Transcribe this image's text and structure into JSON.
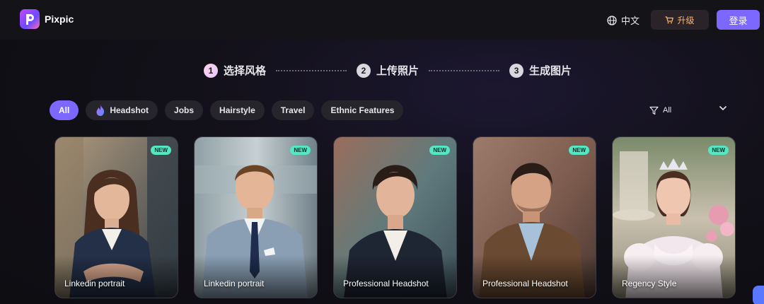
{
  "header": {
    "app_name": "Pixpic",
    "language_label": "中文",
    "upgrade_label": "升级",
    "login_label": "登录"
  },
  "steps": [
    {
      "num": "1",
      "label": "选择风格",
      "active": true
    },
    {
      "num": "2",
      "label": "上传照片",
      "active": false
    },
    {
      "num": "3",
      "label": "生成图片",
      "active": false
    }
  ],
  "filters": {
    "chips": [
      "All",
      "Headshot",
      "Jobs",
      "Hairstyle",
      "Travel",
      "Ethnic Features"
    ],
    "active": "All",
    "select_value": "All"
  },
  "cards": [
    {
      "label": "Linkedin portrait",
      "badge": "NEW"
    },
    {
      "label": "Linkedin portrait",
      "badge": "NEW"
    },
    {
      "label": "Professional Headshot",
      "badge": "NEW"
    },
    {
      "label": "Professional Headshot",
      "badge": "NEW"
    },
    {
      "label": "Regency Style",
      "badge": "NEW"
    }
  ],
  "colors": {
    "accent": "#7c68ff",
    "badge": "#52e8c4",
    "upgrade_text": "#ffb26b"
  }
}
